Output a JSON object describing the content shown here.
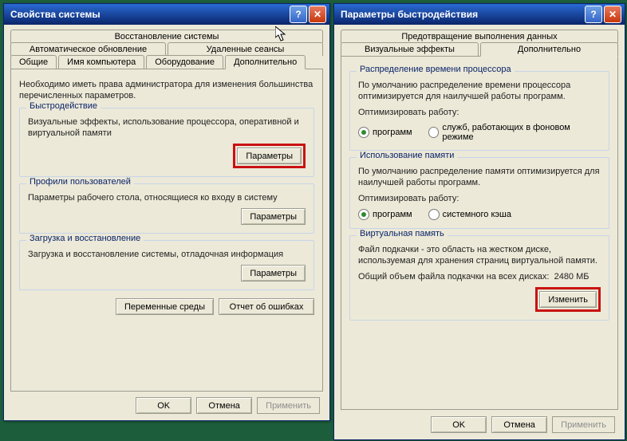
{
  "global": {
    "ok": "OK",
    "cancel": "Отмена",
    "apply": "Применить"
  },
  "win1": {
    "title": "Свойства системы",
    "tabs": {
      "restore": "Восстановление системы",
      "auto_update": "Автоматическое обновление",
      "remote": "Удаленные сеансы",
      "general": "Общие",
      "computer_name": "Имя компьютера",
      "hardware": "Оборудование",
      "advanced": "Дополнительно"
    },
    "admin_note": "Необходимо иметь права администратора для изменения большинства перечисленных параметров.",
    "perf": {
      "title": "Быстродействие",
      "text": "Визуальные эффекты, использование процессора, оперативной и виртуальной памяти",
      "button": "Параметры"
    },
    "profiles": {
      "title": "Профили пользователей",
      "text": "Параметры рабочего стола, относящиеся ко входу в систему",
      "button": "Параметры"
    },
    "startup": {
      "title": "Загрузка и восстановление",
      "text": "Загрузка и восстановление системы, отладочная информация",
      "button": "Параметры"
    },
    "env_vars": "Переменные среды",
    "error_report": "Отчет об ошибках"
  },
  "win2": {
    "title": "Параметры быстродействия",
    "tabs": {
      "dep": "Предотвращение выполнения данных",
      "visual": "Визуальные эффекты",
      "advanced": "Дополнительно"
    },
    "cpu": {
      "title": "Распределение времени процессора",
      "text": "По умолчанию распределение времени процессора оптимизируется для наилучшей работы программ.",
      "optimize": "Оптимизировать работу:",
      "opt_programs": "программ",
      "opt_services": "служб, работающих в фоновом режиме"
    },
    "mem": {
      "title": "Использование памяти",
      "text": "По умолчанию распределение памяти оптимизируется для наилучшей работы программ.",
      "optimize": "Оптимизировать работу:",
      "opt_programs": "программ",
      "opt_cache": "системного кэша"
    },
    "vm": {
      "title": "Виртуальная память",
      "text": "Файл подкачки - это область на жестком диске, используемая для хранения страниц виртуальной памяти.",
      "total_label": "Общий объем файла подкачки на всех дисках:",
      "total_value": "2480 МБ",
      "change": "Изменить"
    }
  }
}
